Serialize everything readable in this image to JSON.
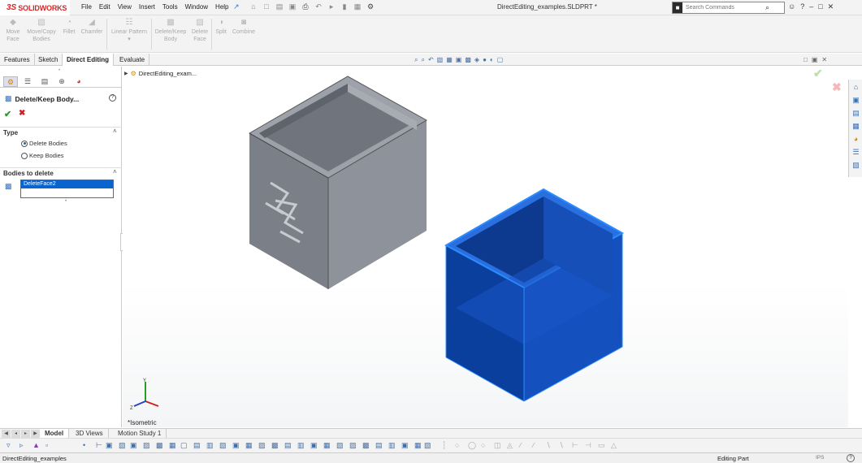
{
  "app": {
    "logo_ds": "3S",
    "logo_text": "SOLIDWORKS",
    "menus": [
      "File",
      "Edit",
      "View",
      "Insert",
      "Tools",
      "Window",
      "Help"
    ],
    "document_title": "DirectEditing_examples.SLDPRT *",
    "search_placeholder": "Search Commands",
    "search_icon": "search-icon"
  },
  "command_manager": {
    "items": [
      {
        "label": "Move\nFace",
        "icon": "move-face-icon"
      },
      {
        "label": "Move/Copy\nBodies",
        "icon": "move-copy-bodies-icon"
      },
      {
        "label": "Fillet",
        "icon": "fillet-icon"
      },
      {
        "label": "Chamfer",
        "icon": "chamfer-icon"
      },
      {
        "label": "Linear Pattern",
        "icon": "linear-pattern-icon"
      },
      {
        "label": "Delete/Keep\nBody",
        "icon": "delete-keep-body-icon"
      },
      {
        "label": "Delete\nFace",
        "icon": "delete-face-icon"
      },
      {
        "label": "Split",
        "icon": "split-icon"
      },
      {
        "label": "Combine",
        "icon": "combine-icon"
      }
    ]
  },
  "tabs": [
    "Features",
    "Sketch",
    "Direct Editing",
    "Evaluate"
  ],
  "active_tab": "Direct Editing",
  "property_manager": {
    "title": "Delete/Keep Body...",
    "type_group": "Type",
    "options": [
      "Delete Bodies",
      "Keep Bodies"
    ],
    "selected_option": "Delete Bodies",
    "bodies_group": "Bodies to delete",
    "bodies": [
      "DeleteFace2"
    ]
  },
  "graphics": {
    "tree_node": "DirectEditing_exam...",
    "view_name": "*Isometric",
    "colors": {
      "grey_box_front": "#7b7f88",
      "grey_box_side": "#8e929b",
      "blue_box": "#1a4fb8",
      "blue_box_edge": "#2a8cff"
    }
  },
  "bottom_tabs": [
    "Model",
    "3D Views",
    "Motion Study 1"
  ],
  "active_bottom_tab": "Model",
  "status": {
    "file": "DirectEditing_examples",
    "mode": "Editing Part",
    "units": "IPS"
  }
}
